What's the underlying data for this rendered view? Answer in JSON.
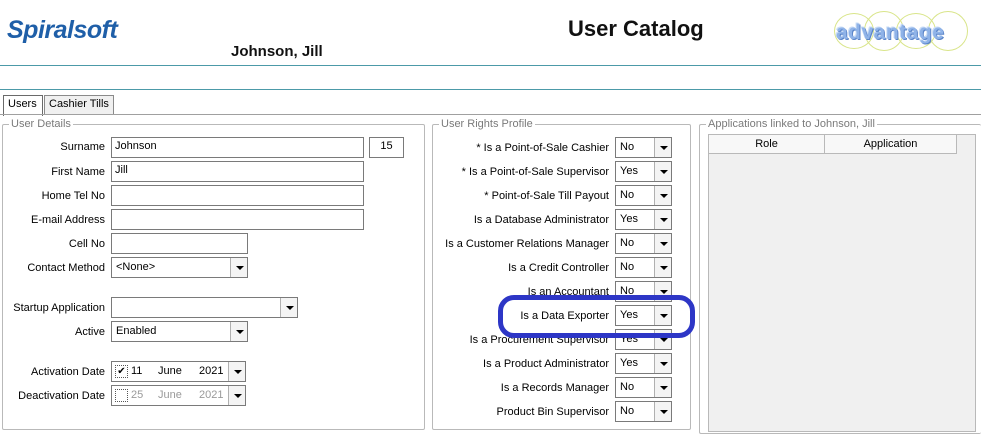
{
  "header": {
    "logo_text": "Spiralsoft",
    "title": "User Catalog",
    "user_name": "Johnson, Jill",
    "brand_text": "advantage"
  },
  "tabs": [
    {
      "label": "Users",
      "active": true
    },
    {
      "label": "Cashier Tills",
      "active": false
    }
  ],
  "user_details": {
    "legend": "User Details",
    "surname": {
      "label": "Surname",
      "value": "Johnson"
    },
    "id_value": "15",
    "first_name": {
      "label": "First Name",
      "value": "Jill"
    },
    "home_tel": {
      "label": "Home Tel No",
      "value": ""
    },
    "email": {
      "label": "E-mail Address",
      "value": ""
    },
    "cell": {
      "label": "Cell No",
      "value": ""
    },
    "contact_method": {
      "label": "Contact Method",
      "value": "<None>"
    },
    "startup_app": {
      "label": "Startup Application",
      "value": ""
    },
    "active": {
      "label": "Active",
      "value": "Enabled"
    },
    "activation_date": {
      "label": "Activation Date",
      "checked": true,
      "day": "11",
      "month": "June",
      "year": "2021"
    },
    "deactivation_date": {
      "label": "Deactivation Date",
      "checked": false,
      "day": "25",
      "month": "June",
      "year": "2021"
    }
  },
  "rights": {
    "legend": "User Rights Profile",
    "items": [
      {
        "label": "* Is a Point-of-Sale Cashier",
        "value": "No"
      },
      {
        "label": "* Is a Point-of-Sale Supervisor",
        "value": "Yes"
      },
      {
        "label": "* Point-of-Sale Till Payout",
        "value": "No"
      },
      {
        "label": "Is a Database Administrator",
        "value": "Yes"
      },
      {
        "label": "Is a Customer Relations Manager",
        "value": "No"
      },
      {
        "label": "Is a Credit Controller",
        "value": "No"
      },
      {
        "label": "Is an Accountant",
        "value": "No"
      },
      {
        "label": "Is a Data Exporter",
        "value": "Yes"
      },
      {
        "label": "Is a Procurement Supervisor",
        "value": "Yes"
      },
      {
        "label": "Is a Product Administrator",
        "value": "Yes"
      },
      {
        "label": "Is a Records Manager",
        "value": "No"
      },
      {
        "label": "Product Bin Supervisor",
        "value": "No"
      }
    ]
  },
  "applications": {
    "legend": "Applications linked to Johnson, Jill",
    "columns": [
      "Role",
      "Application"
    ]
  },
  "colors": {
    "accent_rule": "#4c9aa8",
    "highlight": "#2d36c6",
    "logo_blue": "#1f5fa8",
    "logo_orange": "#f08a1a"
  }
}
